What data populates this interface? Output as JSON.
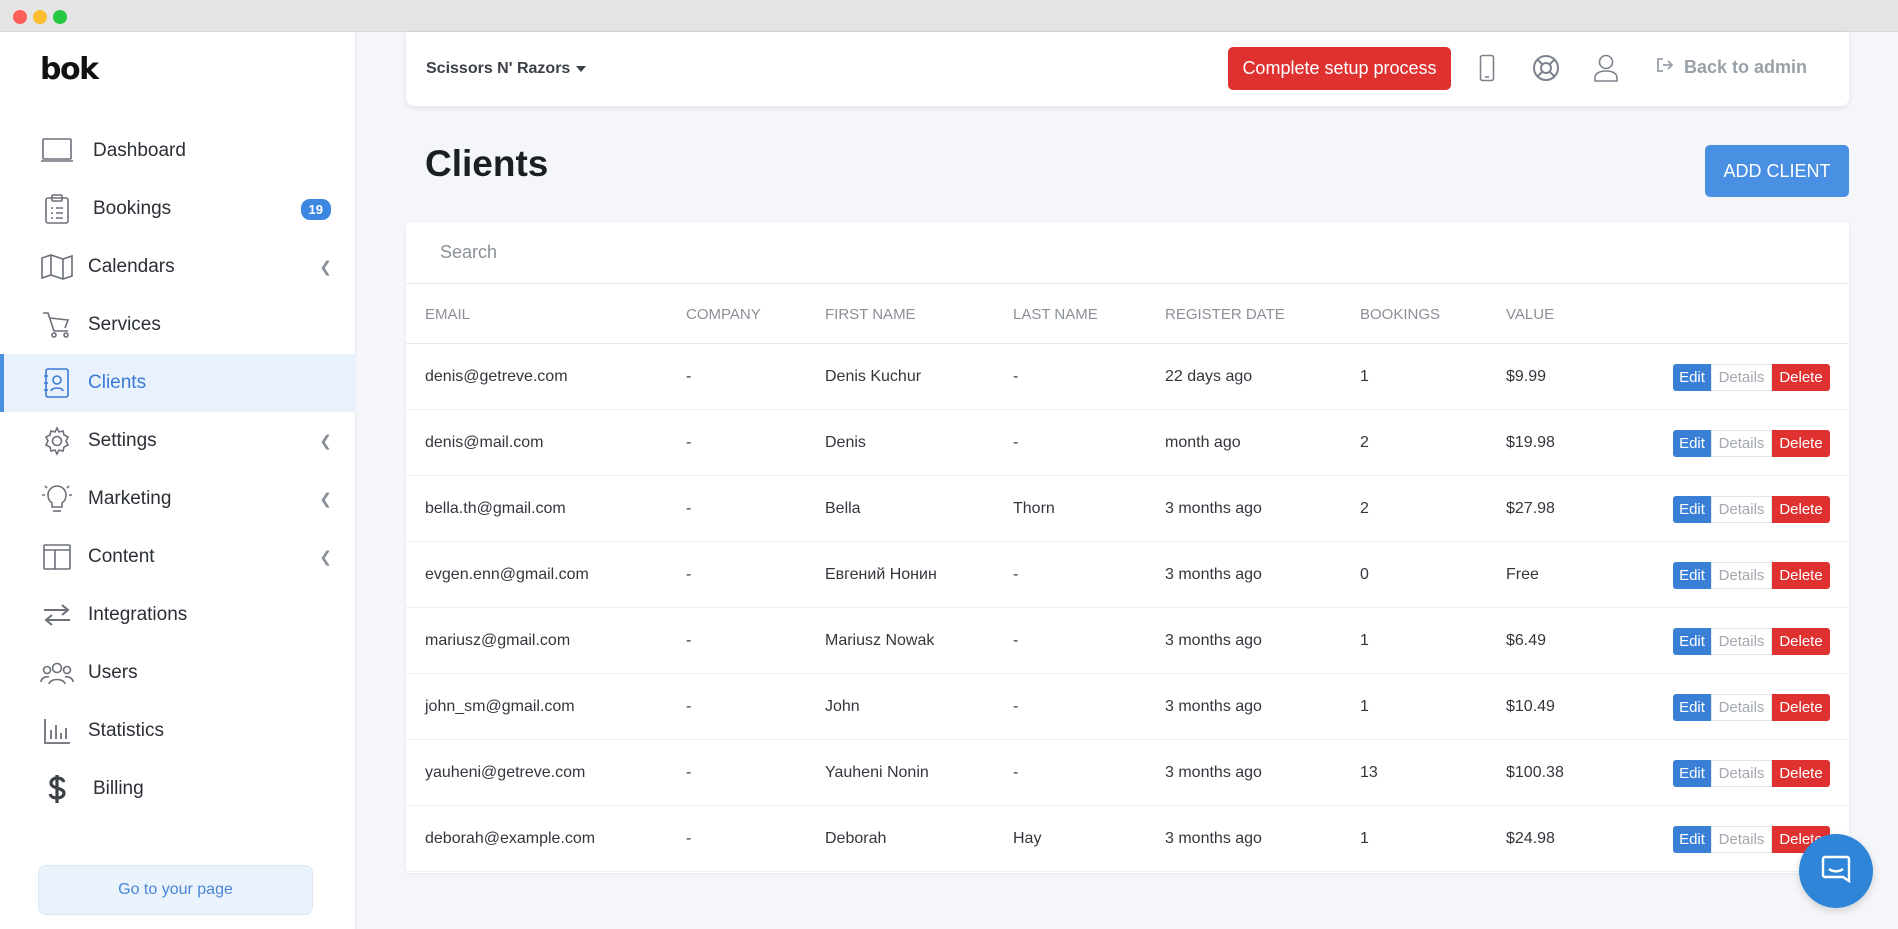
{
  "window": {
    "title": ""
  },
  "sidebar": {
    "logo": "bok",
    "items": [
      {
        "label": "Dashboard",
        "icon": "monitor-icon"
      },
      {
        "label": "Bookings",
        "icon": "clipboard-icon",
        "badge": "19"
      },
      {
        "label": "Calendars",
        "icon": "map-icon"
      },
      {
        "label": "Services",
        "icon": "cart-icon"
      },
      {
        "label": "Clients",
        "icon": "contact-card-icon"
      },
      {
        "label": "Settings",
        "icon": "gear-icon"
      },
      {
        "label": "Marketing",
        "icon": "lightbulb-icon"
      },
      {
        "label": "Content",
        "icon": "columns-icon"
      },
      {
        "label": "Integrations",
        "icon": "arrows-exchange-icon"
      },
      {
        "label": "Users",
        "icon": "users-icon"
      },
      {
        "label": "Statistics",
        "icon": "bar-chart-icon"
      },
      {
        "label": "Billing",
        "icon": "dollar-icon"
      }
    ],
    "goto_page": "Go to your page"
  },
  "topbar": {
    "shop_name": "Scissors N' Razors",
    "setup_button": "Complete setup process",
    "back_admin": "Back to admin"
  },
  "page": {
    "title": "Clients",
    "add_button": "ADD CLIENT"
  },
  "search": {
    "placeholder": "Search"
  },
  "table": {
    "headers": [
      "EMAIL",
      "COMPANY",
      "FIRST NAME",
      "LAST NAME",
      "REGISTER DATE",
      "BOOKINGS",
      "VALUE"
    ],
    "actions": {
      "edit": "Edit",
      "details": "Details",
      "delete": "Delete"
    },
    "rows": [
      [
        "denis@getreve.com",
        "-",
        "Denis Kuchur",
        "-",
        "22 days ago",
        "1",
        "$9.99"
      ],
      [
        "denis@mail.com",
        "-",
        "Denis",
        "-",
        "month ago",
        "2",
        "$19.98"
      ],
      [
        "bella.th@gmail.com",
        "-",
        "Bella",
        "Thorn",
        "3 months ago",
        "2",
        "$27.98"
      ],
      [
        "evgen.enn@gmail.com",
        "-",
        "Евгений Нонин",
        "-",
        "3 months ago",
        "0",
        "Free"
      ],
      [
        "mariusz@gmail.com",
        "-",
        "Mariusz Nowak",
        "-",
        "3 months ago",
        "1",
        "$6.49"
      ],
      [
        "john_sm@gmail.com",
        "-",
        "John",
        "-",
        "3 months ago",
        "1",
        "$10.49"
      ],
      [
        "yauheni@getreve.com",
        "-",
        "Yauheni Nonin",
        "-",
        "3 months ago",
        "13",
        "$100.38"
      ],
      [
        "deborah@example.com",
        "-",
        "Deborah",
        "Hay",
        "3 months ago",
        "1",
        "$24.98"
      ]
    ]
  },
  "colors": {
    "accent": "#4a90e2",
    "danger": "#e03131",
    "active_bg": "#e8f1fc",
    "chat": "#2f86d8"
  }
}
